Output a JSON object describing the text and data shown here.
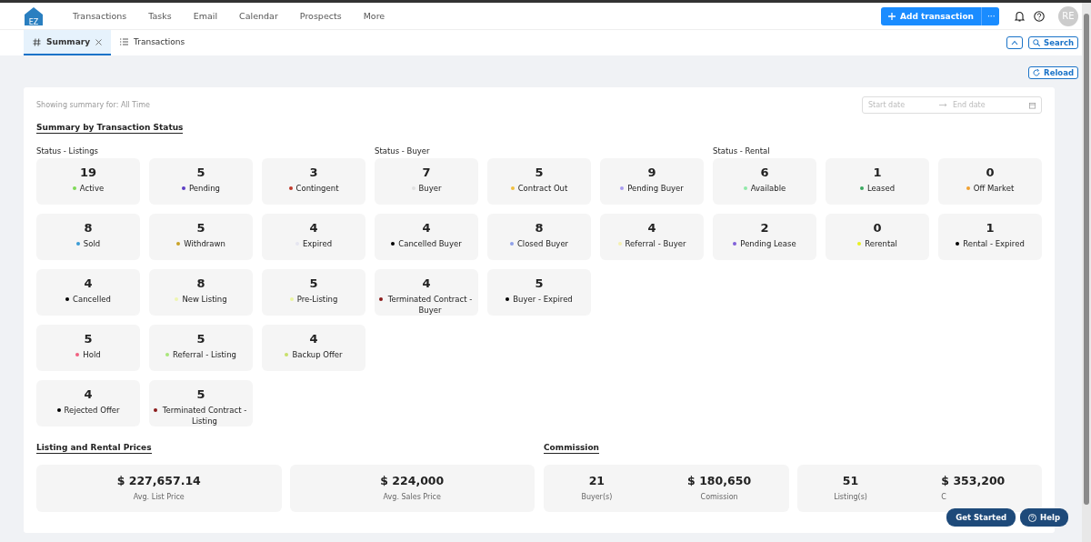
{
  "nav": {
    "logo_text": "EZ",
    "items": [
      "Transactions",
      "Tasks",
      "Email",
      "Calendar",
      "Prospects",
      "More"
    ],
    "add_button": "Add transaction",
    "more_button": "···",
    "avatar": "RE"
  },
  "tabs": [
    {
      "label": "Summary",
      "closable": true,
      "selected": true
    },
    {
      "label": "Transactions",
      "closable": false,
      "selected": false
    }
  ],
  "tab_actions": {
    "search": "Search"
  },
  "reload": "Reload",
  "summary": {
    "showing": "Showing summary for: All Time",
    "date_range": {
      "start_placeholder": "Start date",
      "end_placeholder": "End date"
    },
    "title": "Summary by Transaction Status",
    "groups": [
      {
        "title": "Status - Listings",
        "items": [
          {
            "count": "19",
            "label": "Active",
            "color": "#7ed957"
          },
          {
            "count": "5",
            "label": "Pending",
            "color": "#5b3cc4"
          },
          {
            "count": "3",
            "label": "Contingent",
            "color": "#c0392b"
          },
          {
            "count": "8",
            "label": "Sold",
            "color": "#3a9bd5"
          },
          {
            "count": "5",
            "label": "Withdrawn",
            "color": "#c9a227"
          },
          {
            "count": "4",
            "label": "Expired",
            "color": "#e6e6f0"
          },
          {
            "count": "4",
            "label": "Cancelled",
            "color": "#000000"
          },
          {
            "count": "8",
            "label": "New Listing",
            "color": "#eef5b0"
          },
          {
            "count": "5",
            "label": "Pre-Listing",
            "color": "#eaf5a0"
          },
          {
            "count": "5",
            "label": "Hold",
            "color": "#f06080"
          },
          {
            "count": "5",
            "label": "Referral - Listing",
            "color": "#a8e67a"
          },
          {
            "count": "4",
            "label": "Backup Offer",
            "color": "#c8e06a"
          },
          {
            "count": "4",
            "label": "Rejected Offer",
            "color": "#000000"
          },
          {
            "count": "5",
            "label": "Terminated Contract - Listing",
            "color": "#8b1a1a"
          }
        ]
      },
      {
        "title": "Status - Buyer",
        "items": [
          {
            "count": "7",
            "label": "Buyer",
            "color": "#e0e0e0"
          },
          {
            "count": "5",
            "label": "Contract Out",
            "color": "#f0c040"
          },
          {
            "count": "9",
            "label": "Pending Buyer",
            "color": "#a89cf0"
          },
          {
            "count": "4",
            "label": "Cancelled Buyer",
            "color": "#000000"
          },
          {
            "count": "8",
            "label": "Closed Buyer",
            "color": "#8fa0e8"
          },
          {
            "count": "4",
            "label": "Referral - Buyer",
            "color": "#f5f0b0"
          },
          {
            "count": "4",
            "label": "Terminated Contract - Buyer",
            "color": "#8b1a1a"
          },
          {
            "count": "5",
            "label": "Buyer - Expired",
            "color": "#000000"
          }
        ]
      },
      {
        "title": "Status - Rental",
        "items": [
          {
            "count": "6",
            "label": "Available",
            "color": "#90e8a8"
          },
          {
            "count": "1",
            "label": "Leased",
            "color": "#3aa860"
          },
          {
            "count": "0",
            "label": "Off Market",
            "color": "#f0a030"
          },
          {
            "count": "2",
            "label": "Pending Lease",
            "color": "#8060d8"
          },
          {
            "count": "0",
            "label": "Rerental",
            "color": "#e8f020"
          },
          {
            "count": "1",
            "label": "Rental - Expired",
            "color": "#000000"
          }
        ]
      }
    ]
  },
  "prices": {
    "title": "Listing and Rental Prices",
    "cards": [
      {
        "value": "$ 227,657.14",
        "label": "Avg. List Price"
      },
      {
        "value": "$ 224,000",
        "label": "Avg. Sales Price"
      }
    ]
  },
  "commission": {
    "title": "Commission",
    "cards": [
      {
        "count": "21",
        "count_label": "Buyer(s)",
        "value": "$ 180,650",
        "label": "Comission"
      },
      {
        "count": "51",
        "count_label": "Listing(s)",
        "value": "$ 353,200",
        "label": "C"
      }
    ]
  },
  "floating": {
    "get_started": "Get Started",
    "help": "Help"
  }
}
